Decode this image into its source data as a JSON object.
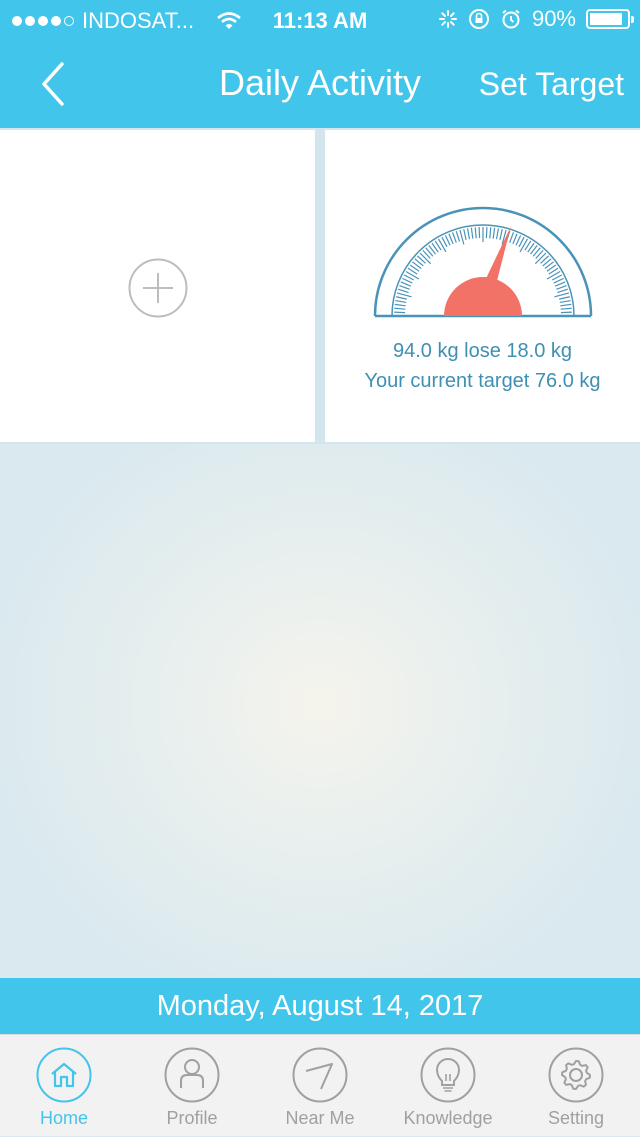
{
  "status_bar": {
    "carrier": "INDOSAT...",
    "time": "11:13 AM",
    "battery_percent": "90%",
    "battery_level": 0.9,
    "signal_bars_filled": 4,
    "signal_bars_total": 5
  },
  "nav": {
    "title": "Daily Activity",
    "action_label": "Set Target",
    "back_icon": "chevron-left-icon"
  },
  "weight_card": {
    "line1": "94.0 kg lose 18.0 kg",
    "line2": "Your current target 76.0 kg",
    "accent_color": "#f27268",
    "gauge_color": "#4a93b8"
  },
  "add_card": {
    "icon": "plus-circle-icon"
  },
  "date_bar": {
    "text": "Monday, August 14, 2017"
  },
  "tabs": [
    {
      "label": "Home",
      "icon": "home-icon",
      "active": true
    },
    {
      "label": "Profile",
      "icon": "person-icon",
      "active": false
    },
    {
      "label": "Near Me",
      "icon": "compass-icon",
      "active": false
    },
    {
      "label": "Knowledge",
      "icon": "lightbulb-icon",
      "active": false
    },
    {
      "label": "Setting",
      "icon": "gear-icon",
      "active": false
    }
  ],
  "colors": {
    "primary": "#42c5ea",
    "tab_inactive": "#a0a0a0"
  }
}
